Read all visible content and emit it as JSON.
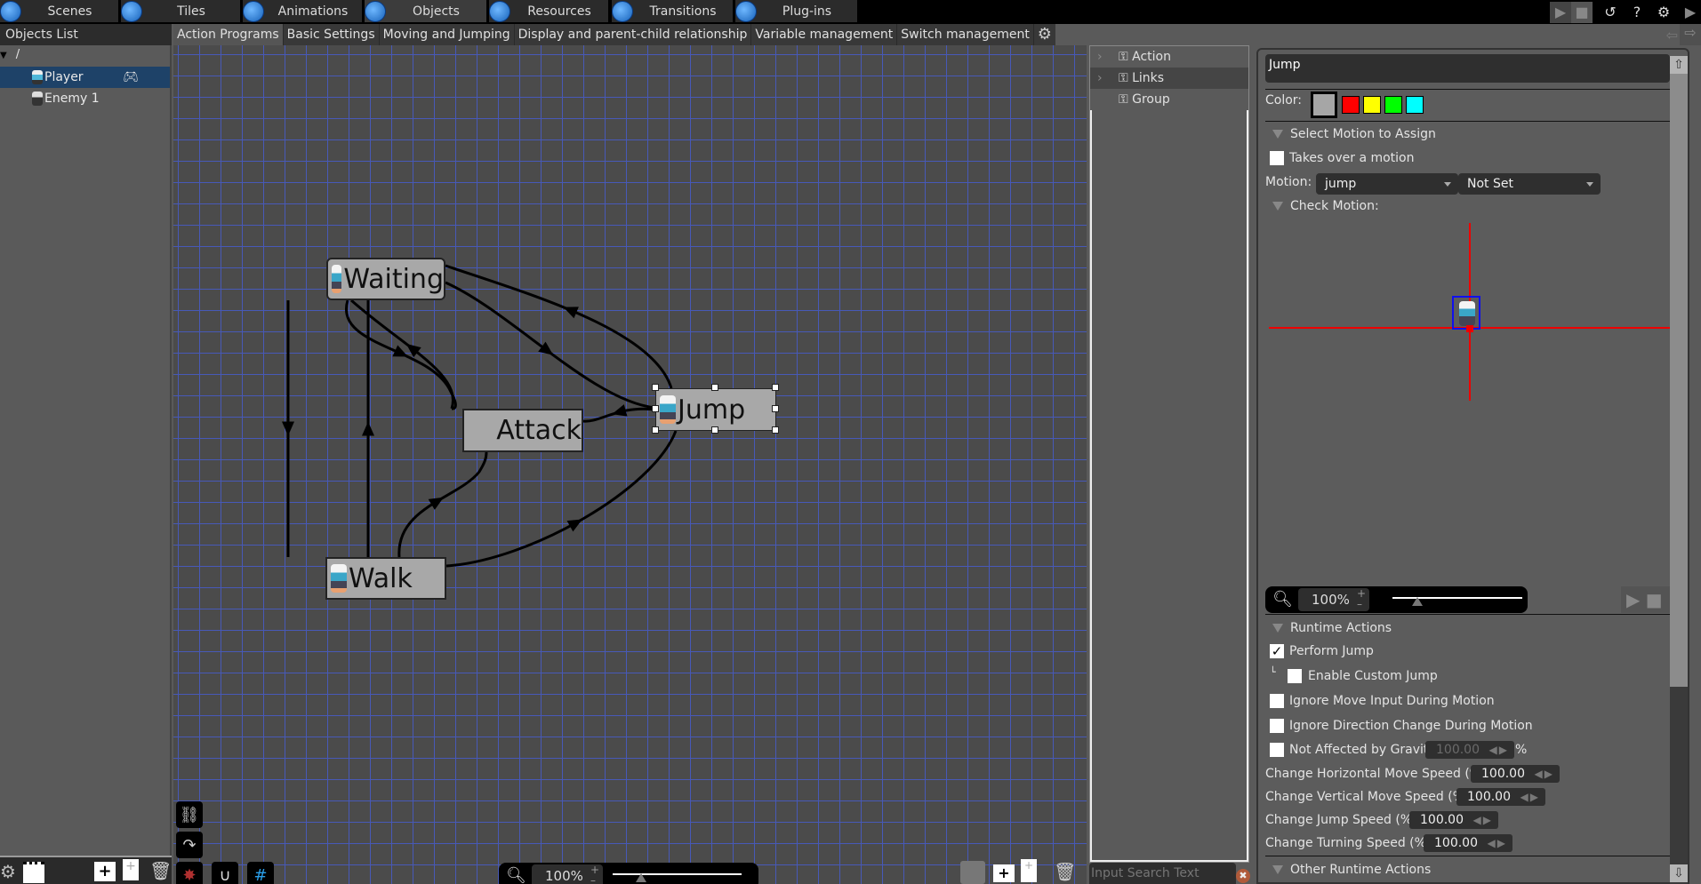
{
  "top_tabs": [
    {
      "label": "Scenes",
      "icon": "scenes-icon",
      "active": false
    },
    {
      "label": "Tiles",
      "icon": "tiles-icon",
      "active": false
    },
    {
      "label": "Animations",
      "icon": "animations-icon",
      "active": false
    },
    {
      "label": "Objects",
      "icon": "objects-icon",
      "active": true
    },
    {
      "label": "Resources",
      "icon": "resources-icon",
      "active": false
    },
    {
      "label": "Transitions",
      "icon": "transitions-icon",
      "active": false
    },
    {
      "label": "Plug-ins",
      "icon": "plugins-icon",
      "active": false
    }
  ],
  "top_right_icons": [
    "play-icon",
    "stop-icon",
    "undo-icon",
    "help-icon",
    "settings-icon",
    "run-icon"
  ],
  "sidebar": {
    "title": "Objects List",
    "root": "/",
    "items": [
      {
        "label": "Player",
        "selected": true,
        "badge": "gamepad-icon"
      },
      {
        "label": "Enemy 1",
        "selected": false
      }
    ]
  },
  "sub_tabs": [
    {
      "label": "Action Programs",
      "active": true
    },
    {
      "label": "Basic Settings",
      "active": false
    },
    {
      "label": "Moving and Jumping",
      "active": false
    },
    {
      "label": "Display and parent-child relationship",
      "active": false
    },
    {
      "label": "Variable management",
      "active": false
    },
    {
      "label": "Switch management",
      "active": false
    }
  ],
  "graph": {
    "nodes": [
      {
        "id": "waiting",
        "label": "Waiting",
        "selected": false
      },
      {
        "id": "attack",
        "label": "Attack",
        "selected": false
      },
      {
        "id": "jump",
        "label": "Jump",
        "selected": true
      },
      {
        "id": "walk",
        "label": "Walk",
        "selected": false
      }
    ],
    "links": [
      {
        "from": "waiting",
        "to": "walk"
      },
      {
        "from": "walk",
        "to": "waiting"
      },
      {
        "from": "waiting",
        "to": "attack"
      },
      {
        "from": "attack",
        "to": "waiting"
      },
      {
        "from": "waiting",
        "to": "jump"
      },
      {
        "from": "jump",
        "to": "waiting"
      },
      {
        "from": "jump",
        "to": "attack"
      },
      {
        "from": "walk",
        "to": "attack"
      },
      {
        "from": "walk",
        "to": "jump"
      }
    ]
  },
  "canvas_zoom": "100%",
  "action_panel": {
    "items": [
      "Action",
      "Links",
      "Group"
    ],
    "search_placeholder": "Input Search Text"
  },
  "props": {
    "name": "Jump",
    "color_label": "Color:",
    "colors": [
      "#a6a6a6",
      "#ff0000",
      "#ffff00",
      "#00ff00",
      "#00ffff"
    ],
    "select_motion_header": "Select Motion to Assign",
    "takes_over_label": "Takes over a motion",
    "takes_over_checked": false,
    "motion_label": "Motion:",
    "motion_value": "jump",
    "motion_variant": "Not Set",
    "check_motion_header": "Check Motion:",
    "preview_zoom": "100%",
    "runtime_header": "Runtime Actions",
    "perform_jump_label": "Perform Jump",
    "perform_jump_checked": true,
    "custom_jump_label": "Enable Custom Jump",
    "ignore_move_label": "Ignore Move Input During Motion",
    "ignore_dir_label": "Ignore Direction Change During Motion",
    "gravity_label": "Not Affected by Gravity",
    "gravity_value": "100.00",
    "gravity_unit": "%",
    "hspeed_label": "Change Horizontal Move Speed (%):",
    "hspeed_value": "100.00",
    "vspeed_label": "Change Vertical Move Speed (%):",
    "vspeed_value": "100.00",
    "jspeed_label": "Change Jump Speed (%):",
    "jspeed_value": "100.00",
    "tspeed_label": "Change Turning Speed (%):",
    "tspeed_value": "100.00",
    "other_header": "Other Runtime Actions"
  }
}
